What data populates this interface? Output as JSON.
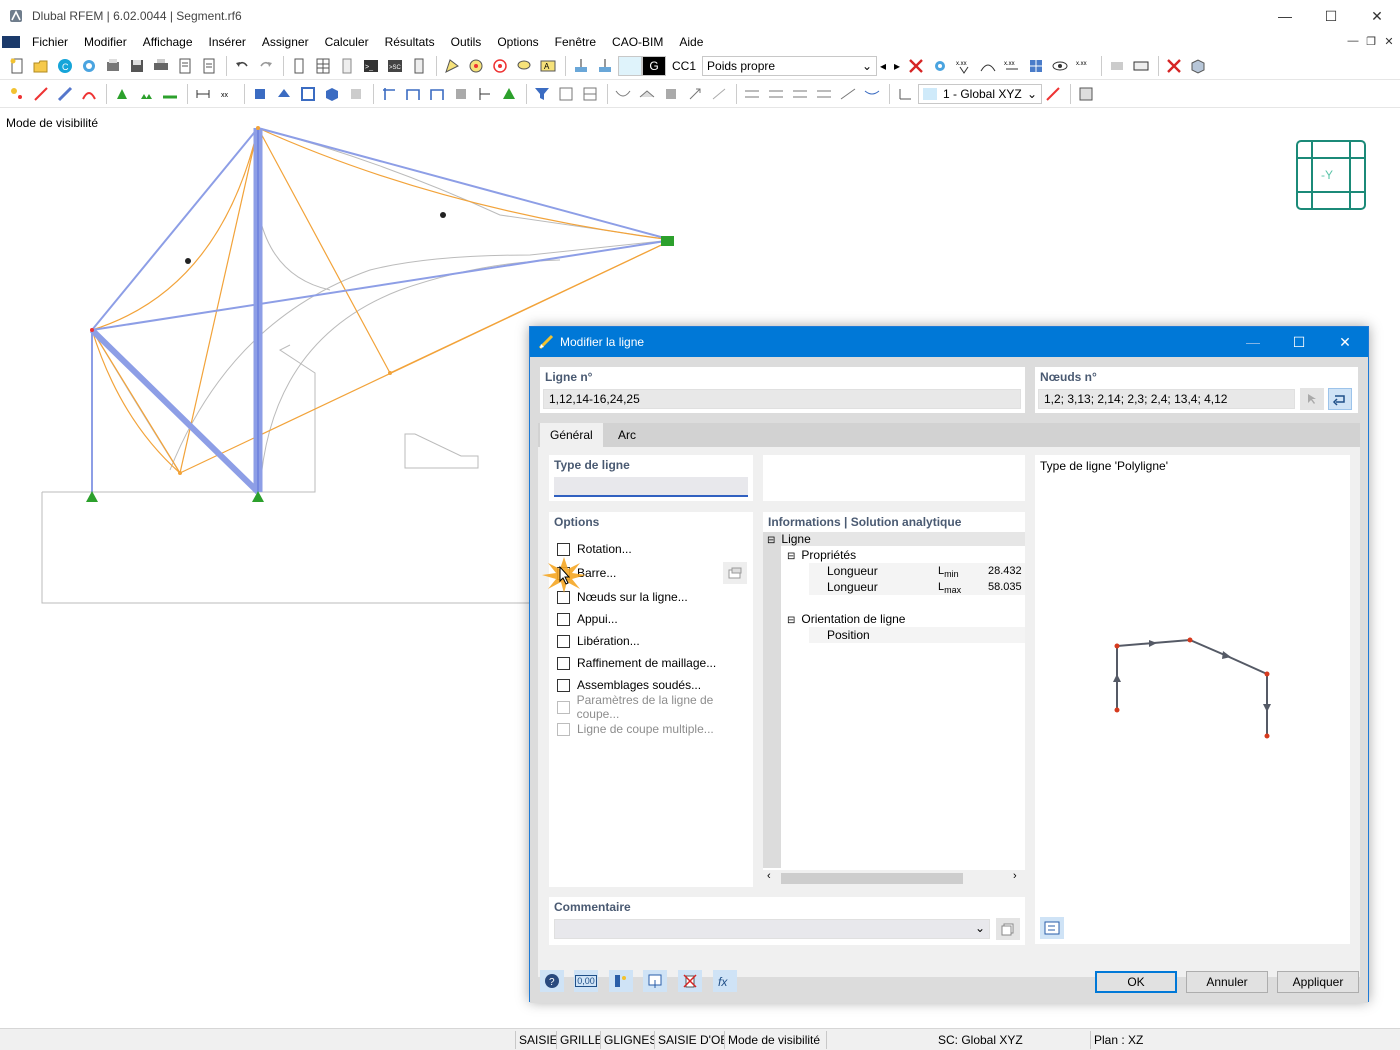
{
  "window": {
    "title": "Dlubal RFEM | 6.02.0044 | Segment.rf6",
    "minimize": "—",
    "maximize": "☐",
    "close": "✕"
  },
  "menu": {
    "items": [
      "Fichier",
      "Modifier",
      "Affichage",
      "Insérer",
      "Assigner",
      "Calculer",
      "Résultats",
      "Outils",
      "Options",
      "Fenêtre",
      "CAO-BIM",
      "Aide"
    ]
  },
  "toolbar": {
    "load_type": "G",
    "load_case": "CC1",
    "load_case_name": "Poids propre",
    "coord_system": "1 - Global XYZ"
  },
  "canvas": {
    "visibility_mode_label": "Mode de visibilité",
    "view_cube_label": "-Y"
  },
  "dialog": {
    "title": "Modifier la ligne",
    "line_no_label": "Ligne n°",
    "line_no_value": "1,12,14-16,24,25",
    "nodes_no_label": "Nœuds n°",
    "nodes_no_value": "1,2; 3,13; 2,14; 2,3; 2,4; 13,4; 4,12",
    "tabs": [
      "Général",
      "Arc"
    ],
    "line_type_label": "Type de ligne",
    "line_type_value": "",
    "preview_title": "Type de ligne 'Polyligne'",
    "options_label": "Options",
    "options": [
      {
        "label": "Rotation...",
        "enabled": true
      },
      {
        "label": "Barre...",
        "enabled": true
      },
      {
        "label": "Nœuds sur la ligne...",
        "enabled": true
      },
      {
        "label": "Appui...",
        "enabled": true
      },
      {
        "label": "Libération...",
        "enabled": true
      },
      {
        "label": "Raffinement de maillage...",
        "enabled": true
      },
      {
        "label": "Assemblages soudés...",
        "enabled": true
      },
      {
        "label": "Paramètres de la ligne de coupe...",
        "enabled": false
      },
      {
        "label": "Ligne de coupe multiple...",
        "enabled": false
      }
    ],
    "info_title": "Informations | Solution analytique",
    "info_tree": {
      "root": "Ligne",
      "properties": "Propriétés",
      "length_label": "Longueur",
      "lmin_sym": "L",
      "lmin_sub": "min",
      "lmin_value": "28.432",
      "lmax_sym": "L",
      "lmax_sub": "max",
      "lmax_value": "58.035",
      "orientation": "Orientation de ligne",
      "position": "Position"
    },
    "comment_label": "Commentaire",
    "comment_value": "",
    "buttons": {
      "ok": "OK",
      "cancel": "Annuler",
      "apply": "Appliquer"
    },
    "footer_icons": [
      "help-icon",
      "units-icon",
      "nodes-icon",
      "view-icon",
      "delete-icon",
      "formula-icon"
    ],
    "units_caption": "0,00"
  },
  "statusbar": {
    "items": [
      "SAISIE",
      "GRILLE",
      "GLIGNES",
      "SAISIE D'OB",
      "Mode de visibilité"
    ],
    "coord_system": "SC: Global XYZ",
    "plane": "Plan : XZ"
  },
  "colors": {
    "accent": "#0078d7",
    "member_blue": "#8d9ee6",
    "orange_line": "#f2a33a",
    "panel_title": "#4a5a72"
  }
}
